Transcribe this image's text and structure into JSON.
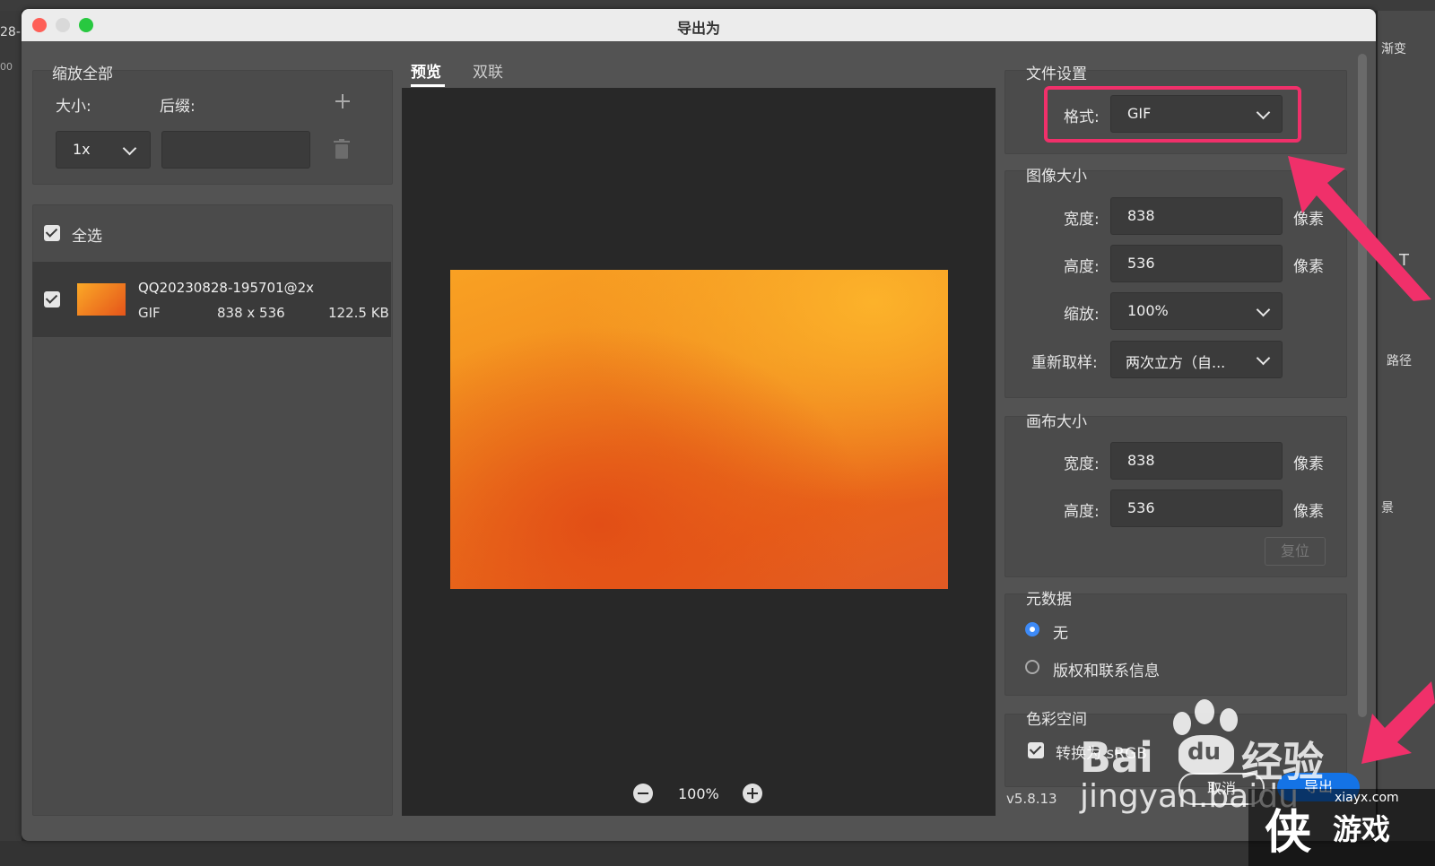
{
  "dialog": {
    "title": "导出为"
  },
  "left": {
    "scale_all": "缩放全部",
    "size_label": "大小:",
    "suffix_label": "后缀:",
    "size_value": "1x",
    "suffix_placeholder": "",
    "select_all": "全选",
    "file": {
      "name": "QQ20230828-195701@2x",
      "format": "GIF",
      "dimensions": "838 x 536",
      "filesize": "122.5 KB"
    }
  },
  "tabs": [
    "预览",
    "双联"
  ],
  "zoom": {
    "level": "100%"
  },
  "file_settings": {
    "heading": "文件设置",
    "format_label": "格式:",
    "format_value": "GIF"
  },
  "image_size": {
    "heading": "图像大小",
    "width_label": "宽度:",
    "width_value": "838",
    "width_unit": "像素",
    "height_label": "高度:",
    "height_value": "536",
    "height_unit": "像素",
    "scale_label": "缩放:",
    "scale_value": "100%",
    "resample_label": "重新取样:",
    "resample_value": "两次立方（自..."
  },
  "canvas_size": {
    "heading": "画布大小",
    "width_label": "宽度:",
    "width_value": "838",
    "width_unit": "像素",
    "height_label": "高度:",
    "height_value": "536",
    "height_unit": "像素",
    "reset": "复位"
  },
  "metadata": {
    "heading": "元数据",
    "none": "无",
    "copyright": "版权和联系信息"
  },
  "color_space": {
    "heading": "色彩空间",
    "convert": "转换为 sRGB"
  },
  "footer": {
    "version": "v5.8.13",
    "cancel": "取消",
    "export": "导出"
  },
  "watermark": {
    "baidu": "Bai",
    "du": "du",
    "jingyan": "经验",
    "url": "jingyan.baidu",
    "site": "xiayx.com",
    "game": "游戏",
    "xia": "侠"
  },
  "background": {
    "left_text": [
      "28-",
      "00"
    ],
    "right_text": [
      "渐变",
      "T",
      "路径",
      "景"
    ]
  },
  "colors": {
    "highlight": "#f0306a",
    "accent": "#3d8af7"
  }
}
